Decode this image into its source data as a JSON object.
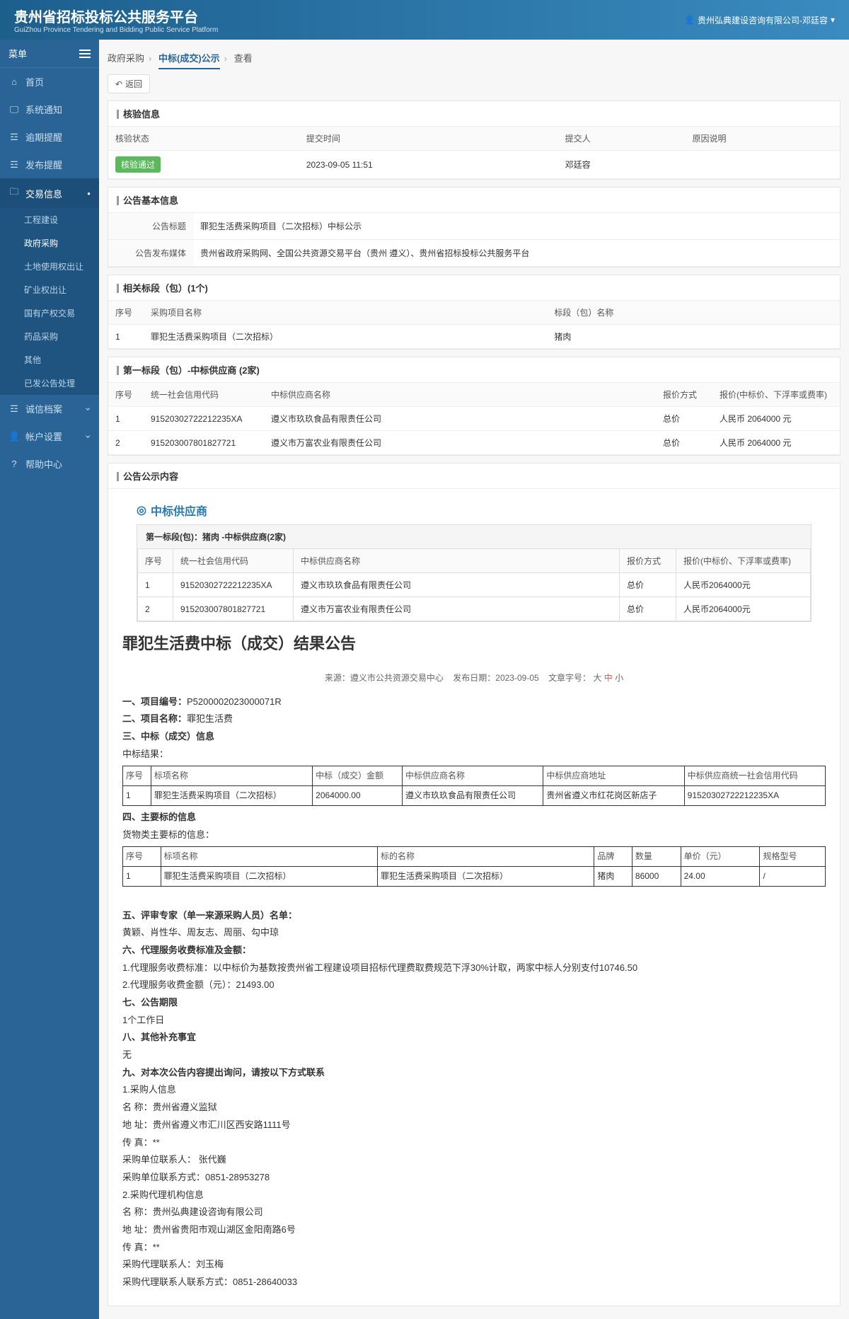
{
  "header": {
    "title_cn": "贵州省招标投标公共服务平台",
    "title_en": "GuiZhou Province Tendering and Bidding Public Service Platform",
    "user": "贵州弘典建设咨询有限公司-邓廷容"
  },
  "sidebar": {
    "head": "菜单",
    "items": [
      {
        "icon": "⌂",
        "label": "首页"
      },
      {
        "icon": "🖵",
        "label": "系统通知"
      },
      {
        "icon": "☲",
        "label": "逾期提醒"
      },
      {
        "icon": "☲",
        "label": "发布提醒"
      },
      {
        "icon": "🗀",
        "label": "交易信息",
        "active": true
      },
      {
        "icon": "☲",
        "label": "诚信档案"
      },
      {
        "icon": "👤",
        "label": "帐户设置"
      },
      {
        "icon": "?",
        "label": "帮助中心"
      }
    ],
    "sub_items": [
      {
        "label": "工程建设"
      },
      {
        "label": "政府采购",
        "sel": true
      },
      {
        "label": "土地使用权出让"
      },
      {
        "label": "矿业权出让"
      },
      {
        "label": "国有产权交易"
      },
      {
        "label": "药品采购"
      },
      {
        "label": "其他"
      },
      {
        "label": "已发公告处理"
      }
    ]
  },
  "breadcrumb": {
    "a": "政府采购",
    "b": "中标(成交)公示",
    "c": "查看"
  },
  "back_btn": "返回",
  "verify": {
    "title": "核验信息",
    "h": [
      "核验状态",
      "提交时间",
      "提交人",
      "原因说明"
    ],
    "status": "核验通过",
    "time": "2023-09-05 11:51",
    "person": "邓廷容",
    "reason": ""
  },
  "basic": {
    "title": "公告基本信息",
    "k1": "公告标题",
    "v1": "罪犯生活费采购项目（二次招标）中标公示",
    "k2": "公告发布媒体",
    "v2": "贵州省政府采购网、全国公共资源交易平台（贵州 遵义）、贵州省招标投标公共服务平台"
  },
  "sections": {
    "title": "相关标段（包）(1个)",
    "h": [
      "序号",
      "采购项目名称",
      "标段（包）名称"
    ],
    "rows": [
      {
        "no": "1",
        "name": "罪犯生活费采购项目（二次招标）",
        "pkg": "猪肉"
      }
    ]
  },
  "bid1": {
    "title": "第一标段（包）-中标供应商 (2家)",
    "h": [
      "序号",
      "统一社会信用代码",
      "中标供应商名称",
      "报价方式",
      "报价(中标价、下浮率或费率)"
    ],
    "rows": [
      {
        "no": "1",
        "code": "91520302722212235XA",
        "name": "遵义市玖玖食品有限责任公司",
        "mode": "总价",
        "price": "人民币 2064000 元"
      },
      {
        "no": "2",
        "code": "915203007801827721",
        "name": "遵义市万富农业有限责任公司",
        "mode": "总价",
        "price": "人民币 2064000 元"
      }
    ]
  },
  "content_pane": {
    "title": "公告公示内容",
    "sup_head": "中标供应商",
    "inner_tab": "第一标段(包)：猪肉 -中标供应商(2家)",
    "inner_h": [
      "序号",
      "统一社会信用代码",
      "中标供应商名称",
      "报价方式",
      "报价(中标价、下浮率或费率)"
    ],
    "inner_rows": [
      {
        "no": "1",
        "code": "91520302722212235XA",
        "name": "遵义市玖玖食品有限责任公司",
        "mode": "总价",
        "price": "人民币2064000元"
      },
      {
        "no": "2",
        "code": "915203007801827721",
        "name": "遵义市万富农业有限责任公司",
        "mode": "总价",
        "price": "人民币2064000元"
      }
    ]
  },
  "article": {
    "title": "罪犯生活费中标（成交）结果公告",
    "meta_source_lbl": "来源：",
    "meta_source": "遵义市公共资源交易中心",
    "meta_date_lbl": "发布日期：",
    "meta_date": "2023-09-05",
    "meta_font_lbl": "文章字号：",
    "meta_font_big": "大",
    "meta_font_mid": "中",
    "meta_font_small": "小",
    "l1": "一、项目编号：",
    "l1v": "P5200002023000071R",
    "l2": "二、项目名称：",
    "l2v": "罪犯生活费",
    "l3": "三、中标（成交）信息",
    "l3a": "中标结果：",
    "t1h": [
      "序号",
      "标项名称",
      "中标（成交）金额",
      "中标供应商名称",
      "中标供应商地址",
      "中标供应商统一社会信用代码"
    ],
    "t1r": [
      "1",
      "罪犯生活费采购项目（二次招标）",
      "2064000.00",
      "遵义市玖玖食品有限责任公司",
      "贵州省遵义市红花岗区新店子",
      "91520302722212235XA"
    ],
    "l4": "四、主要标的信息",
    "l4a": "货物类主要标的信息：",
    "t2h": [
      "序号",
      "标项名称",
      "标的名称",
      "品牌",
      "数量",
      "单价（元）",
      "规格型号"
    ],
    "t2r": [
      "1",
      "罪犯生活费采购项目（二次招标）",
      "罪犯生活费采购项目（二次招标）",
      "猪肉",
      "86000",
      "24.00",
      "/"
    ],
    "l5": "五、评审专家（单一来源采购人员）名单：",
    "l5v": "黄颖、肖性华、周友志、周丽、勾中琼",
    "l6": "六、代理服务收费标准及金额：",
    "l6a": "1.代理服务收费标准：以中标价为基数按贵州省工程建设项目招标代理费取费规范下浮30%计取，两家中标人分别支付10746.50",
    "l6b": "2.代理服务收费金额（元）：21493.00",
    "l7": "七、公告期限",
    "l7v": "1个工作日",
    "l8": "八、其他补充事宜",
    "l8v": "无",
    "l9": "九、对本次公告内容提出询问，请按以下方式联系",
    "c1": "1.采购人信息",
    "c1a": "名 称：贵州省遵义监狱",
    "c1b": "地 址：贵州省遵义市汇川区西安路1111号",
    "c1c": "传 真：**",
    "c1d": "采购单位联系人： 张代巍",
    "c1e": "采购单位联系方式：0851-28953278",
    "c2": "2.采购代理机构信息",
    "c2a": "名 称：贵州弘典建设咨询有限公司",
    "c2b": "地 址：贵州省贵阳市观山湖区金阳南路6号",
    "c2c": "传 真：**",
    "c2d": "采购代理联系人：刘玉梅",
    "c2e": "采购代理联系人联系方式：0851-28640033"
  }
}
